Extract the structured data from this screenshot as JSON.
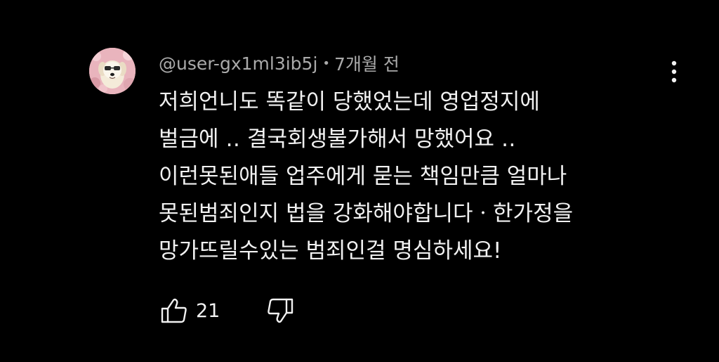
{
  "comment": {
    "author": "@user-gx1ml3ib5j",
    "separator": "•",
    "time": "7개월 전",
    "lines": [
      "저희언니도 똑같이 당했었는데 영업정지에",
      "벌금에 ‥ 결국회생불가해서 망했어요 ‥",
      "이런못된애들 업주에게 묻는 책임만큼 얼마나",
      "못된범죄인지 법을 강화해야합니다ㆍ한가정을",
      "망가뜨릴수있는 범죄인걸 명심하세요!"
    ],
    "like_count": "21",
    "avatar_icon": "dog-avatar",
    "more_icon": "more-vert-icon",
    "like_icon": "thumb-up-icon",
    "dislike_icon": "thumb-down-icon"
  },
  "colors": {
    "background": "#000000",
    "text": "#f1f1f1",
    "meta": "#aaaaaa"
  }
}
